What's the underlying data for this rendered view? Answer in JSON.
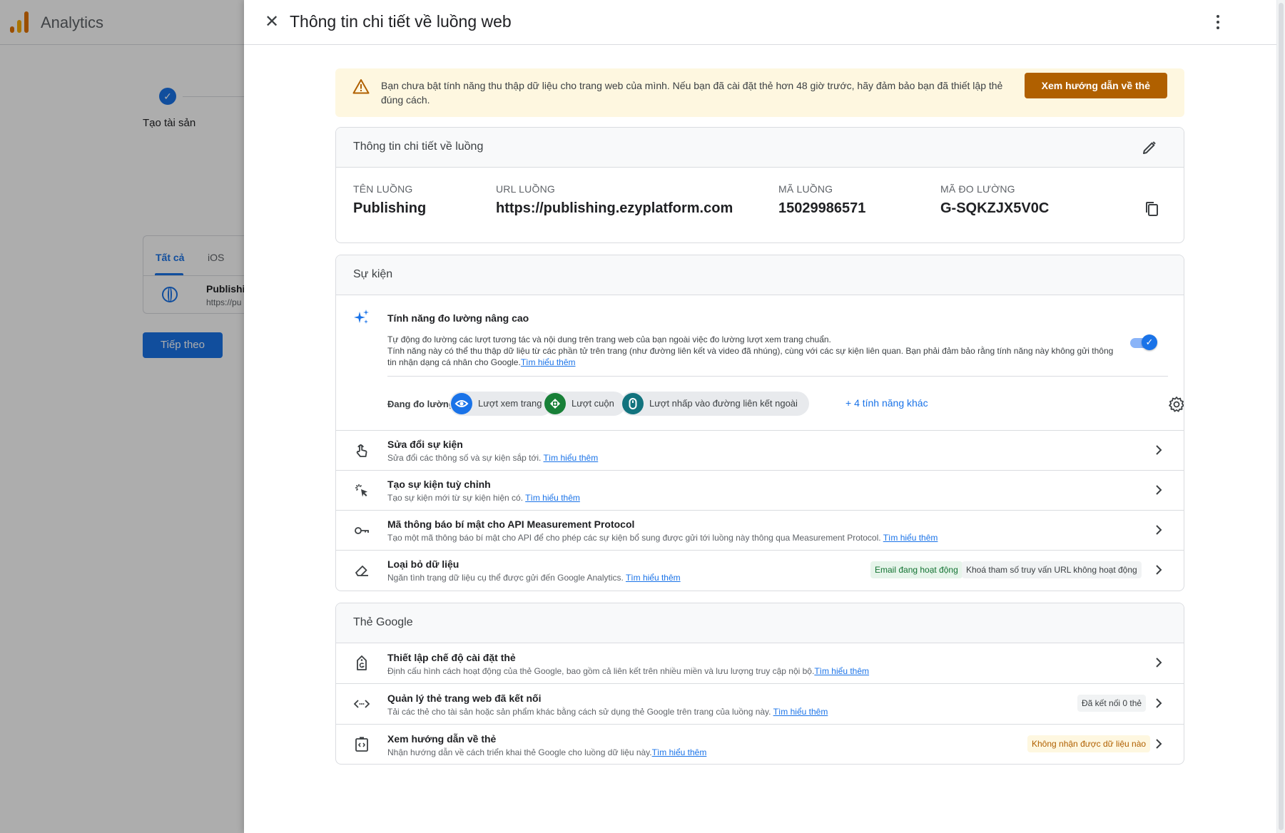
{
  "app": {
    "title": "Analytics"
  },
  "background": {
    "step_label": "Tạo tài sản",
    "tabs": [
      "Tất cả",
      "iOS"
    ],
    "stream_name": "Publishi",
    "stream_url": "https://pu",
    "next_button": "Tiếp theo"
  },
  "panel": {
    "title": "Thông tin chi tiết về luồng web",
    "banner": {
      "text": "Bạn chưa bật tính năng thu thập dữ liệu cho trang web của mình. Nếu bạn đã cài đặt thẻ hơn 48 giờ trước, hãy đảm bảo bạn đã thiết lập thẻ đúng cách.",
      "button": "Xem hướng dẫn về thẻ"
    },
    "details": {
      "heading": "Thông tin chi tiết về luồng",
      "fields": [
        {
          "label": "TÊN LUỒNG",
          "value": "Publishing"
        },
        {
          "label": "URL LUỒNG",
          "value": "https://publishing.ezyplatform.com"
        },
        {
          "label": "MÃ LUỒNG",
          "value": "15029986571"
        },
        {
          "label": "MÃ ĐO LƯỜNG",
          "value": "G-SQKZJX5V0C"
        }
      ]
    },
    "events": {
      "heading": "Sự kiện",
      "enhanced": {
        "title": "Tính năng đo lường nâng cao",
        "desc1": "Tự động đo lường các lượt tương tác và nội dung trên trang web của bạn ngoài việc đo lường lượt xem trang chuẩn.",
        "desc2": "Tính năng này có thể thu thập dữ liệu từ các phần tử trên trang (như đường liên kết và video đã nhúng), cùng với các sự kiện liên quan. Bạn phải đảm bảo rằng tính năng này không gửi thông tin nhận dạng cá nhân cho Google.",
        "learn_more": "Tìm hiểu thêm",
        "measuring_label": "Đang đo lường:",
        "chips": [
          "Lượt xem trang",
          "Lượt cuộn",
          "Lượt nhấp vào đường liên kết ngoài"
        ],
        "more": "+ 4 tính năng khác",
        "enabled": true
      },
      "rows": [
        {
          "title": "Sửa đổi sự kiện",
          "desc": "Sửa đổi các thông số và sự kiện sắp tới.",
          "link": "Tìm hiểu thêm"
        },
        {
          "title": "Tạo sự kiện tuỳ chỉnh",
          "desc": "Tạo sự kiện mới từ sự kiện hiện có.",
          "link": "Tìm hiểu thêm"
        },
        {
          "title": "Mã thông báo bí mật cho API Measurement Protocol",
          "desc": "Tạo một mã thông báo bí mật cho API để cho phép các sự kiện bổ sung được gửi tới luồng này thông qua Measurement Protocol.",
          "link": "Tìm hiểu thêm"
        },
        {
          "title": "Loại bỏ dữ liệu",
          "desc": "Ngăn tình trạng dữ liệu cụ thể được gửi đến Google Analytics.",
          "link": "Tìm hiểu thêm",
          "badge_active": "Email đang hoạt động",
          "badge_inactive": "Khoá tham số truy vấn URL không hoạt động"
        }
      ]
    },
    "google_tag": {
      "heading": "Thẻ Google",
      "rows": [
        {
          "title": "Thiết lập chế độ cài đặt thẻ",
          "desc": "Định cấu hình cách hoạt động của thẻ Google, bao gồm cả liên kết trên nhiều miền và lưu lượng truy cập nội bộ.",
          "link": "Tìm hiểu thêm"
        },
        {
          "title": "Quản lý thẻ trang web đã kết nối",
          "desc": "Tải các thẻ cho tài sản hoặc sản phẩm khác bằng cách sử dụng thẻ Google trên trang của luồng này.",
          "link": "Tìm hiểu thêm",
          "badge": "Đã kết nối 0 thẻ"
        },
        {
          "title": "Xem hướng dẫn về thẻ",
          "desc": "Nhận hướng dẫn về cách triển khai thẻ Google cho luồng dữ liệu này.",
          "link": "Tìm hiểu thêm",
          "badge": "Không nhận được dữ liệu nào"
        }
      ]
    }
  },
  "colors": {
    "accent": "#1a73e8",
    "warning_button": "#b06000",
    "banner_bg": "#fef7e0",
    "chip_page": "#1a73e8",
    "chip_scroll": "#188038",
    "chip_click": "#12737e"
  },
  "icons": [
    "analytics-logo",
    "check-icon",
    "globe-icon",
    "close-icon",
    "more-vert-icon",
    "warning-icon",
    "edit-icon",
    "copy-icon",
    "sparkle-icon",
    "eye-icon",
    "scroll-icon",
    "mouse-icon",
    "gear-icon",
    "touch-icon",
    "cursor-click-icon",
    "key-icon",
    "eraser-icon",
    "tag-icon",
    "code-icon",
    "tag-code-icon",
    "chevron-right-icon"
  ]
}
